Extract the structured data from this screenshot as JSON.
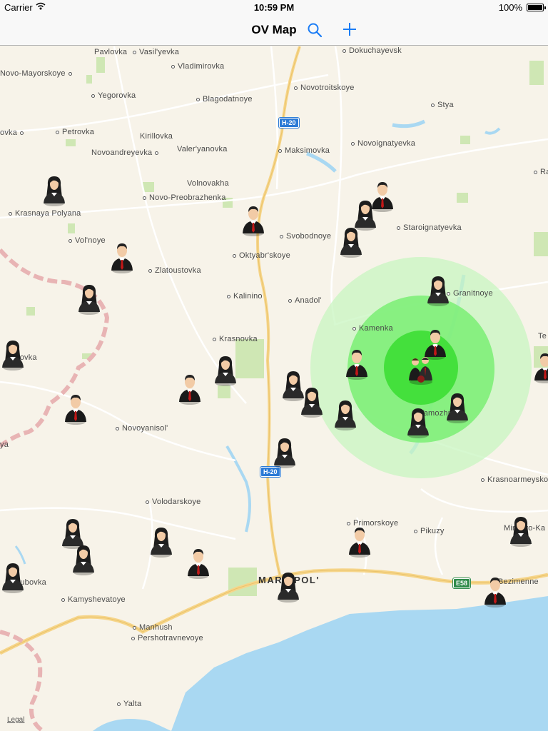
{
  "status": {
    "carrier": "Carrier",
    "time": "10:59 PM",
    "battery": "100%"
  },
  "nav": {
    "title": "OV Map",
    "search_icon": "search-icon",
    "add_icon": "plus-icon"
  },
  "colors": {
    "accent": "#1a7cf5",
    "water": "#a9d8f2",
    "land": "#f7f3e9",
    "highlight_road": "#f6d58a",
    "circle_inner": "#44e03c",
    "circle_mid": "#7aee74",
    "circle_outer": "#c8f5c0"
  },
  "map": {
    "legal": "Legal",
    "city": "MARIUPOL'",
    "shields": [
      "H-20",
      "H-20",
      "E58"
    ],
    "places": [
      "Pavlovka",
      "Vasil'yevka",
      "Dokuchayevsk",
      "Novo-Mayorskoye",
      "Vladimirovka",
      "Novotroitskoye",
      "Yegorovka",
      "Blagodatnoye",
      "Stya",
      "ovka",
      "Petrovka",
      "Kirillovka",
      "Novoandreyevka",
      "Valer'yanovka",
      "Maksimovka",
      "Novoignatyevka",
      "Raz",
      "Volnovakha",
      "Novo-Preobrazhenka",
      "Krasnaya Polyana",
      "Staroignatyevka",
      "Svobodnoye",
      "Vol'noye",
      "Oktyabr'skoye",
      "Zlatoustovka",
      "Granitnoye",
      "Kalinino",
      "Anadol'",
      "Kamenka",
      "Krasnovka",
      "sovka",
      "Te",
      "Novoyanisol'",
      "Tamozhnoye",
      "ya",
      "Krasnoarmeysko",
      "Volodarskoye",
      "Primorskoye",
      "Pikuzy",
      "Mirnovo-Ka",
      "dubovka",
      "Bezimenne",
      "Kamyshevatoye",
      "Manhush",
      "Pershotravnevoye",
      "Yalta"
    ],
    "markers": [
      "female",
      "male",
      "male",
      "female",
      "female",
      "male",
      "female",
      "female",
      "male",
      "male",
      "female",
      "male",
      "female",
      "female",
      "male",
      "male",
      "female",
      "female",
      "female",
      "female",
      "female",
      "male",
      "female",
      "female",
      "female",
      "female",
      "male",
      "male",
      "female",
      "male",
      "female",
      "female",
      "male",
      "male"
    ],
    "cluster": "group"
  }
}
